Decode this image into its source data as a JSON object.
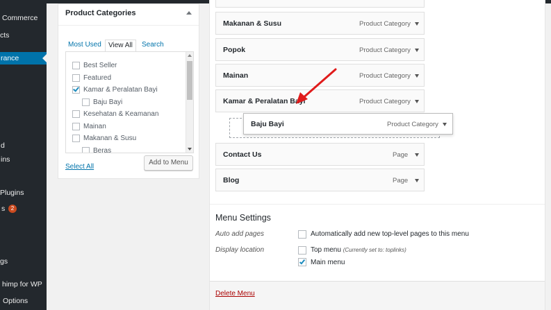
{
  "sidebar": {
    "items": [
      {
        "label": "Commerce"
      },
      {
        "label": "cts"
      },
      {
        "label": "rance"
      },
      {
        "label": "d"
      },
      {
        "label": "ins"
      },
      {
        "label": "Plugins"
      },
      {
        "label": "s",
        "badge": "2"
      },
      {
        "label": "gs"
      },
      {
        "label": "himp for WP"
      },
      {
        "label": "Options"
      }
    ]
  },
  "categories_panel": {
    "title": "Product Categories",
    "tabs": [
      {
        "label": "Most Used"
      },
      {
        "label": "View All"
      },
      {
        "label": "Search"
      }
    ],
    "active_tab": "View All",
    "items": [
      {
        "label": "Best Seller",
        "checked": false
      },
      {
        "label": "Featured",
        "checked": false
      },
      {
        "label": "Kamar & Peralatan Bayi",
        "checked": true
      },
      {
        "label": "Baju Bayi",
        "checked": false
      },
      {
        "label": "Kesehatan & Keamanan",
        "checked": false
      },
      {
        "label": "Mainan",
        "checked": false
      },
      {
        "label": "Makanan & Susu",
        "checked": false
      },
      {
        "label": "Beras",
        "checked": false
      }
    ],
    "select_all": "Select All",
    "add_button": "Add to Menu"
  },
  "menu_items": [
    {
      "name": "Makanan & Susu",
      "type": "Product Category"
    },
    {
      "name": "Popok",
      "type": "Product Category"
    },
    {
      "name": "Mainan",
      "type": "Product Category"
    },
    {
      "name": "Kamar & Peralatan Bayi",
      "type": "Product Category"
    },
    {
      "name": "Baju Bayi",
      "type": "Product Category"
    },
    {
      "name": "Contact Us",
      "type": "Page"
    },
    {
      "name": "Blog",
      "type": "Page"
    }
  ],
  "menu_settings": {
    "title": "Menu Settings",
    "auto_add_label": "Auto add pages",
    "auto_add_text": "Automatically add new top-level pages to this menu",
    "auto_add_checked": false,
    "display_location_label": "Display location",
    "top_menu_text": "Top menu",
    "top_menu_note": "(Currently set to: toplinks)",
    "top_menu_checked": false,
    "main_menu_text": "Main menu",
    "main_menu_checked": true
  },
  "delete_menu": "Delete Menu",
  "colors": {
    "sidebar_bg": "#23282d",
    "active_blue": "#0073aa",
    "link_blue": "#0073aa",
    "badge_orange": "#ca4a1f",
    "delete_red": "#a00",
    "arrow_red": "#e01b1b"
  }
}
